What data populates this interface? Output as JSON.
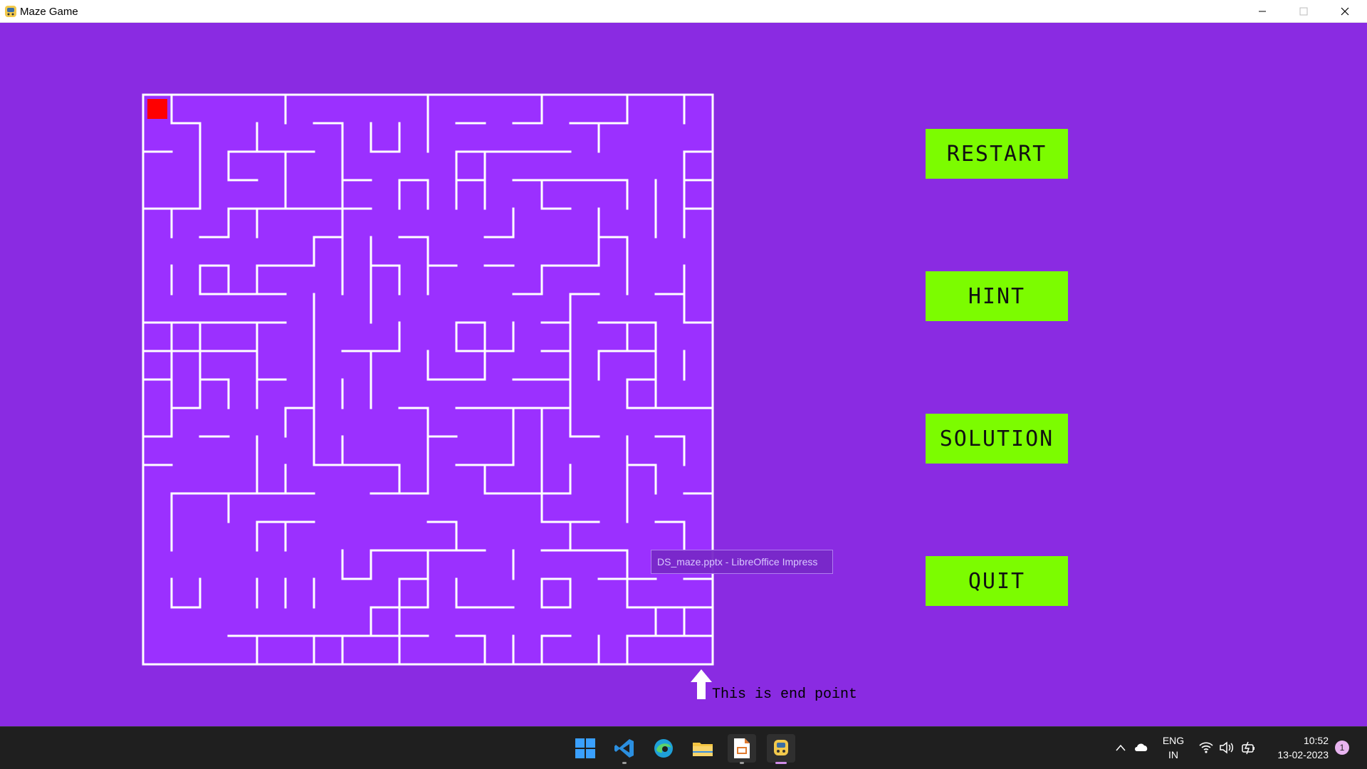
{
  "window": {
    "title": "Maze Game",
    "app_icon": "python-icon"
  },
  "colors": {
    "background": "#8a2be2",
    "maze_floor": "#9b30ff",
    "wall": "#ffffff",
    "player": "#ff0000",
    "button": "#7cfc00"
  },
  "buttons": {
    "restart": "RESTART",
    "hint": "HINT",
    "solution": "SOLUTION",
    "quit": "QUIT"
  },
  "maze": {
    "end_label": "This is end point"
  },
  "tooltip": {
    "text": "DS_maze.pptx - LibreOffice Impress"
  },
  "taskbar": {
    "apps": [
      "windows-start-icon",
      "vscode-icon",
      "edge-icon",
      "file-explorer-icon",
      "libreoffice-impress-icon",
      "python-icon"
    ],
    "language_line1": "ENG",
    "language_line2": "IN",
    "time": "10:52",
    "date": "13-02-2023",
    "notification_count": "1"
  }
}
